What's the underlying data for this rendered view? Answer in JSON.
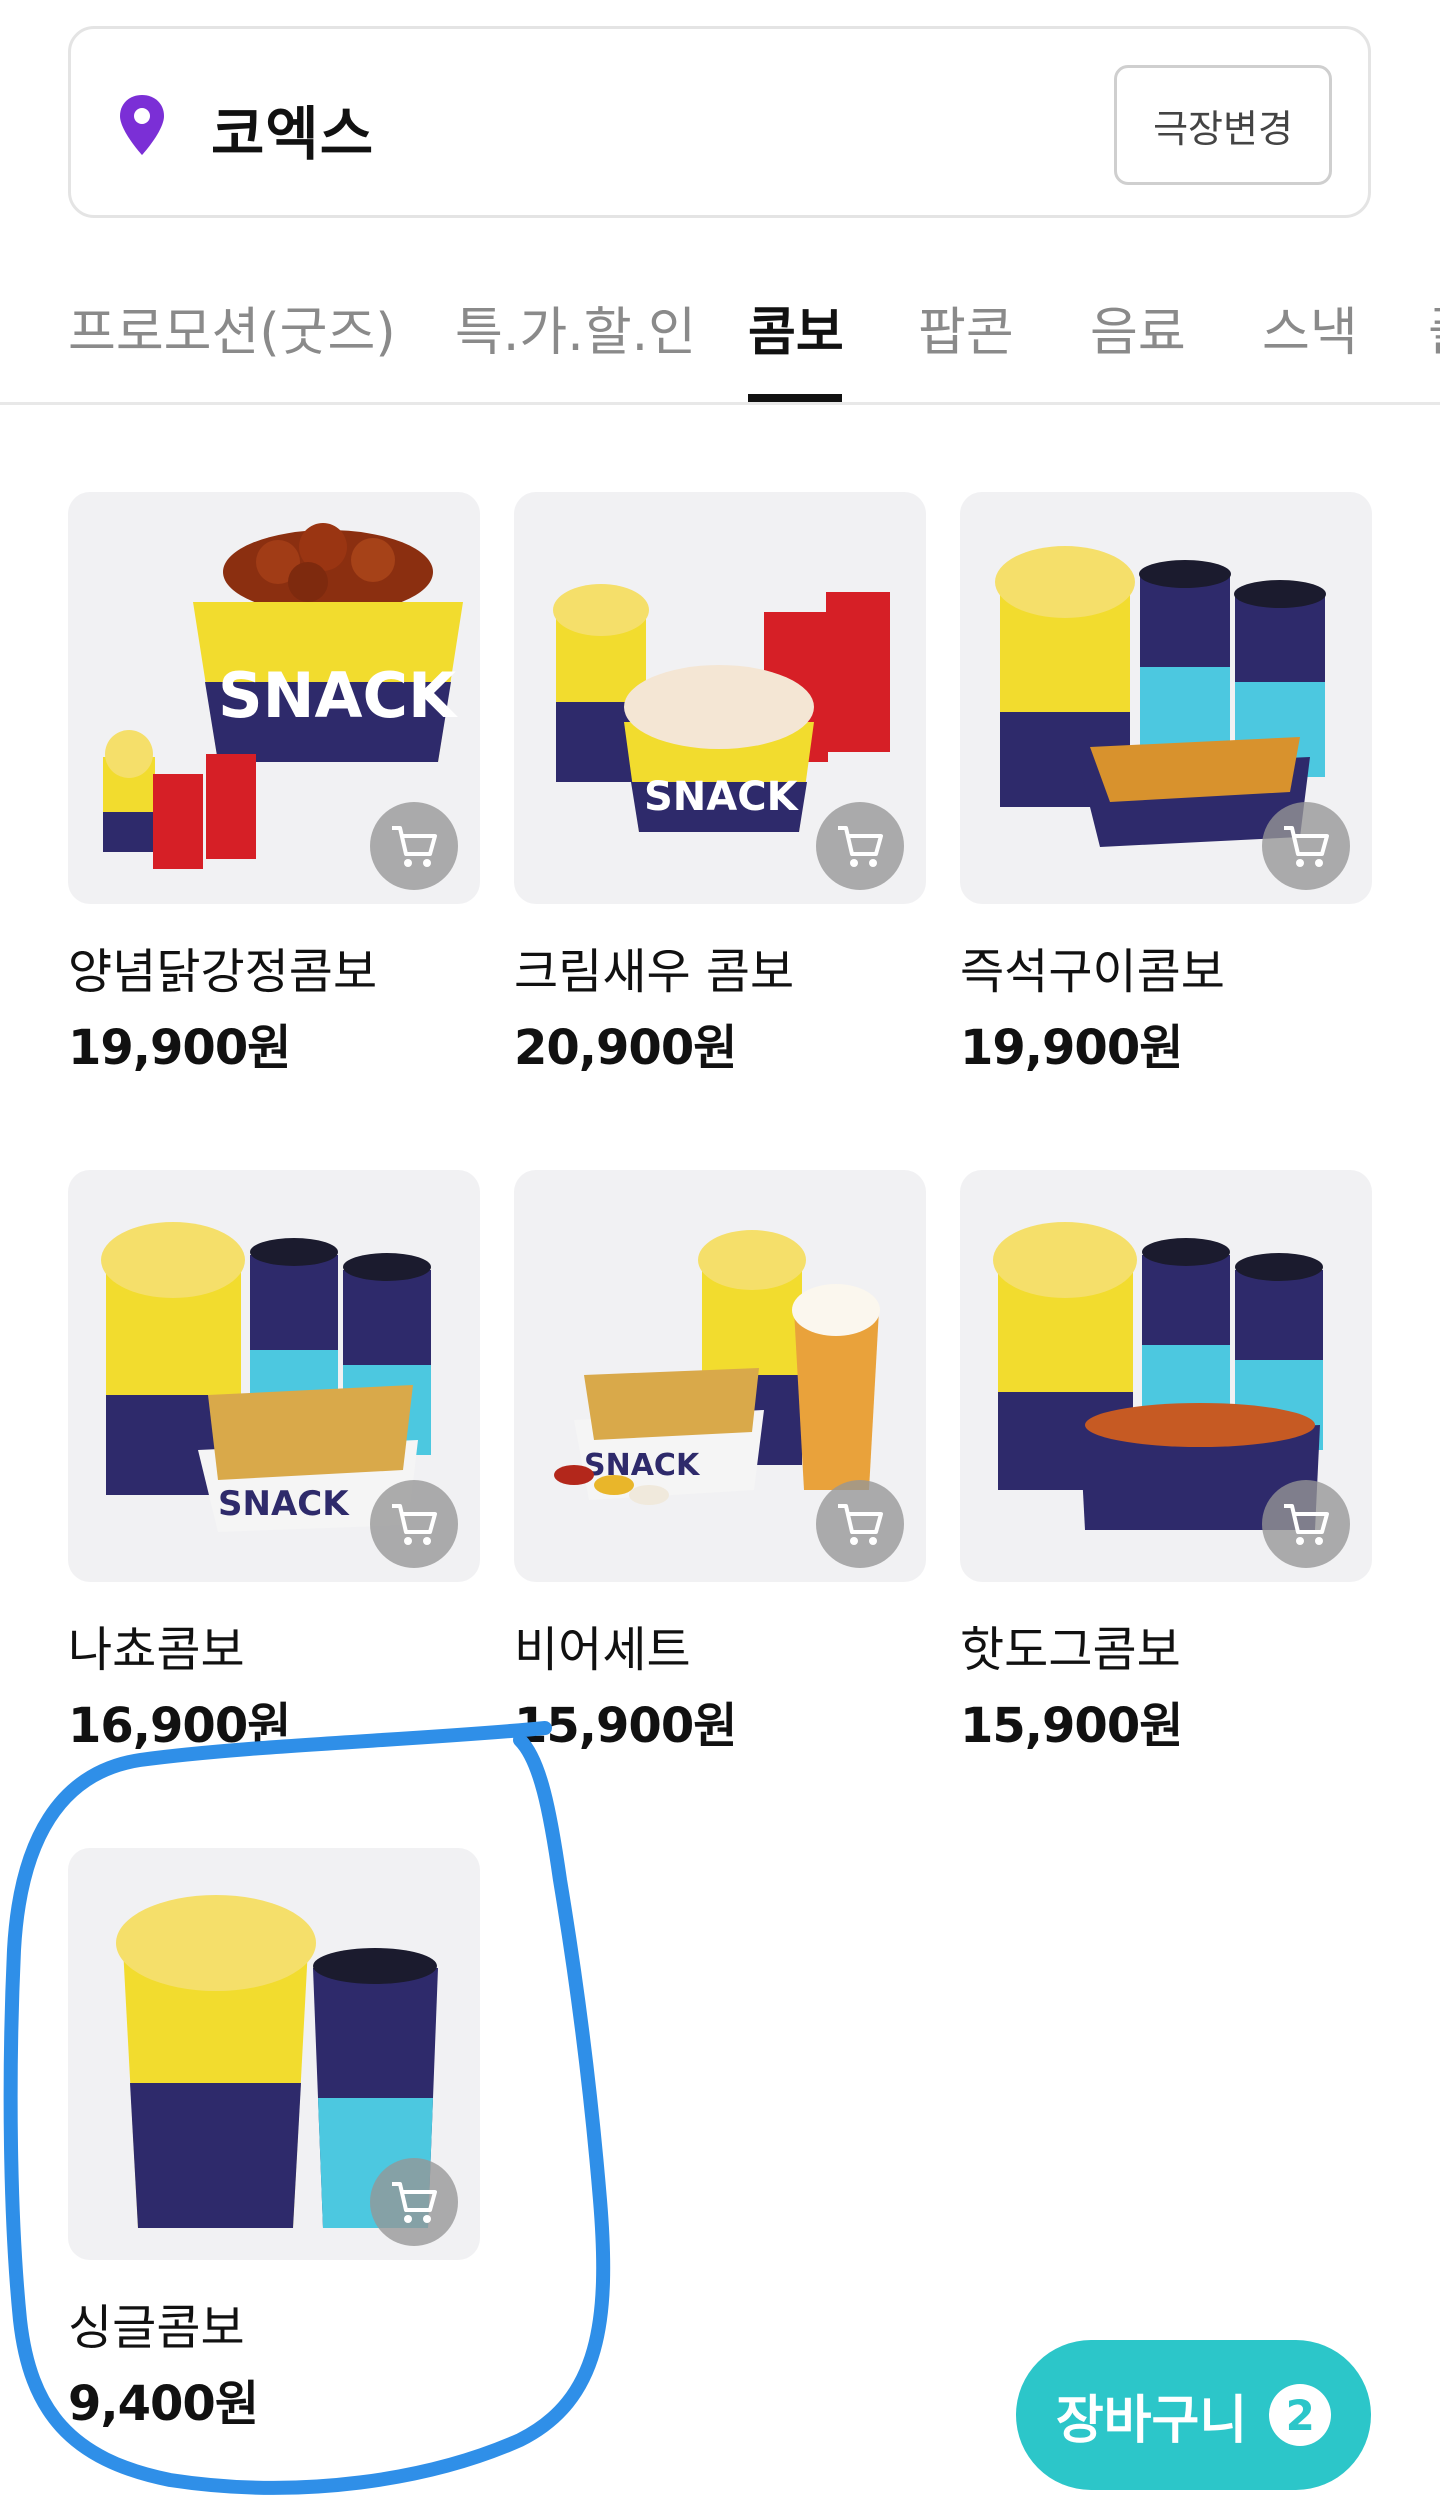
{
  "location": {
    "name": "코엑스",
    "change_label": "극장변경",
    "pin_icon": "location-pin-icon",
    "pin_color": "#7b2fd6"
  },
  "tabs": [
    {
      "label": "프로모션(굿즈)",
      "active": false
    },
    {
      "label": "특.가.할.인",
      "active": false
    },
    {
      "label": "콤보",
      "active": true
    },
    {
      "label": "팝콘",
      "active": false
    },
    {
      "label": "음료",
      "active": false
    },
    {
      "label": "스낵",
      "active": false
    },
    {
      "label": "플",
      "active": false
    }
  ],
  "products": [
    {
      "name": "양념닭강정콤보",
      "price": "19,900원",
      "image": "chicken-combo-image"
    },
    {
      "name": "크림새우 콤보",
      "price": "20,900원",
      "image": "cream-shrimp-combo-image"
    },
    {
      "name": "즉석구이콤보",
      "price": "19,900원",
      "image": "grilled-snack-combo-image"
    },
    {
      "name": "나쵸콤보",
      "price": "16,900원",
      "image": "nacho-combo-image"
    },
    {
      "name": "비어세트",
      "price": "15,900원",
      "image": "beer-set-image"
    },
    {
      "name": "핫도그콤보",
      "price": "15,900원",
      "image": "hotdog-combo-image"
    },
    {
      "name": "싱글콤보",
      "price": "9,400원",
      "image": "single-combo-image"
    }
  ],
  "cart": {
    "label": "장바구니",
    "count": "2",
    "accent_color": "#2cc6c9"
  },
  "annotation": {
    "color": "#2f8fe8",
    "target": "single-combo"
  }
}
